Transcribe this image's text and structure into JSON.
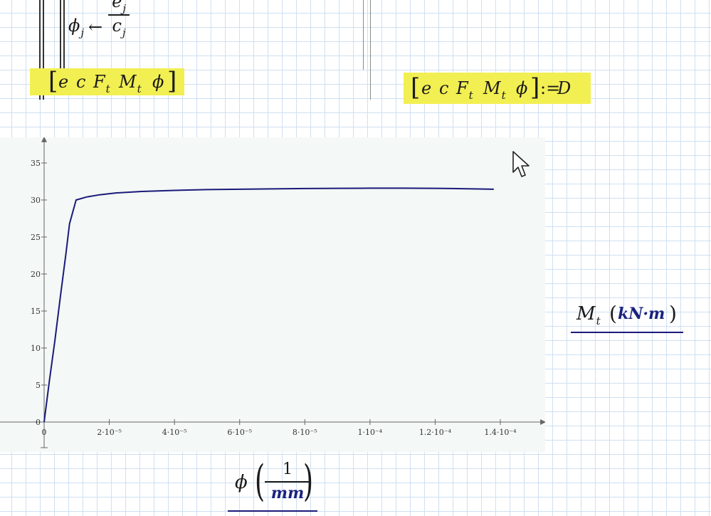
{
  "program": {
    "assign_lhs_sym": "ϕ",
    "assign_lhs_sub": "j",
    "arrow": "←",
    "frac_num_sym": "e",
    "frac_num_sub": "j",
    "frac_den_sym": "c",
    "frac_den_sub": "j",
    "return_vector": {
      "open": "[",
      "e": "e",
      "c": "c",
      "F": "F",
      "F_sub": "t",
      "M": "M",
      "M_sub": "t",
      "phi": "ϕ",
      "close": "]"
    }
  },
  "definition": {
    "open": "[",
    "e": "e",
    "c": "c",
    "F": "F",
    "F_sub": "t",
    "M": "M",
    "M_sub": "t",
    "phi": "ϕ",
    "close": "]",
    "op": ":=",
    "rhs": "D"
  },
  "y_axis_label": {
    "sym": "M",
    "sub": "t",
    "paren_open": "(",
    "unit": "kN·m",
    "paren_close": ")"
  },
  "x_axis_label": {
    "sym": "ϕ",
    "paren_open": "(",
    "num": "1",
    "den": "mm",
    "paren_close": ")"
  },
  "colors": {
    "highlight": "#f2ef52",
    "curve": "#1a1a7a",
    "plot_bg": "#f4f8f6",
    "grid": "#cfe0f1"
  },
  "chart_data": {
    "type": "line",
    "x_tick_labels": [
      "0",
      "2·10⁻⁵",
      "4·10⁻⁵",
      "6·10⁻⁵",
      "8·10⁻⁵",
      "1·10⁻⁴",
      "1.2·10⁻⁴",
      "1.4·10⁻⁴"
    ],
    "x_ticks": [
      0,
      2e-05,
      4e-05,
      6e-05,
      8e-05,
      0.0001,
      0.00012,
      0.00014
    ],
    "y_tick_labels": [
      "0",
      "5",
      "10",
      "15",
      "20",
      "25",
      "30",
      "35"
    ],
    "y_ticks": [
      0,
      5,
      10,
      15,
      20,
      25,
      30,
      35
    ],
    "xlim": [
      0,
      0.000154
    ],
    "ylim": [
      0,
      38
    ],
    "grid": false,
    "series": [
      {
        "x": [
          0,
          1.6e-06,
          3.3e-06,
          5e-06,
          6.7e-06,
          7.8e-06,
          9.8e-06,
          1.3e-05,
          1.7e-05,
          2.2e-05,
          3e-05,
          4e-05,
          5e-05,
          6e-05,
          7e-05,
          8e-05,
          9e-05,
          0.0001,
          0.00011,
          0.00012,
          0.00013,
          0.000138
        ],
        "y": [
          0,
          5.5,
          11,
          17,
          22.8,
          26.8,
          30.0,
          30.4,
          30.7,
          30.95,
          31.15,
          31.3,
          31.4,
          31.45,
          31.5,
          31.55,
          31.58,
          31.6,
          31.6,
          31.58,
          31.52,
          31.45
        ]
      }
    ]
  }
}
